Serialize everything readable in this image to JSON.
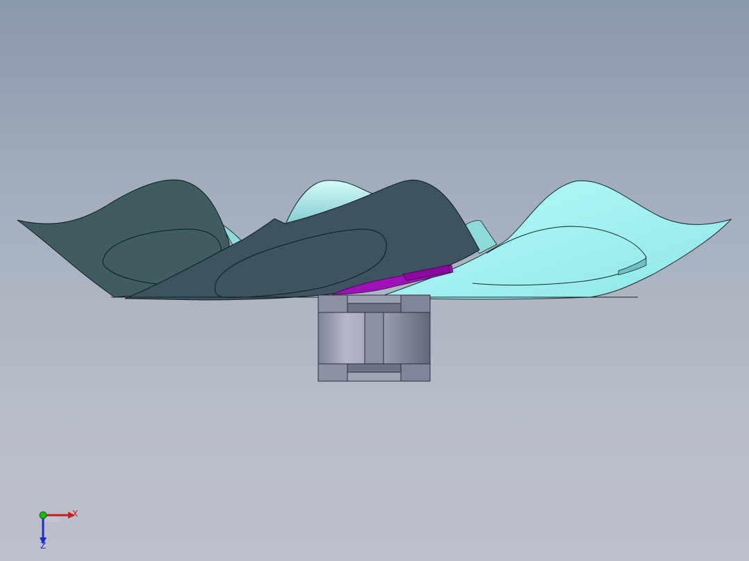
{
  "viewport": {
    "background_top": "#8a98ab",
    "background_bottom": "#bcc0cc",
    "parts": {
      "blade_dark_color": "#3f5c61",
      "blade_mid_color": "#3c5360",
      "blade_light_color": "#a7f7f8",
      "hub_color": "#8f95a6",
      "accent_part_color": "#a010b8"
    }
  },
  "triad": {
    "x_label": "X",
    "z_label": "Z",
    "x_color": "#d01818",
    "y_color": "#18b818",
    "z_color": "#1a2ad0"
  }
}
